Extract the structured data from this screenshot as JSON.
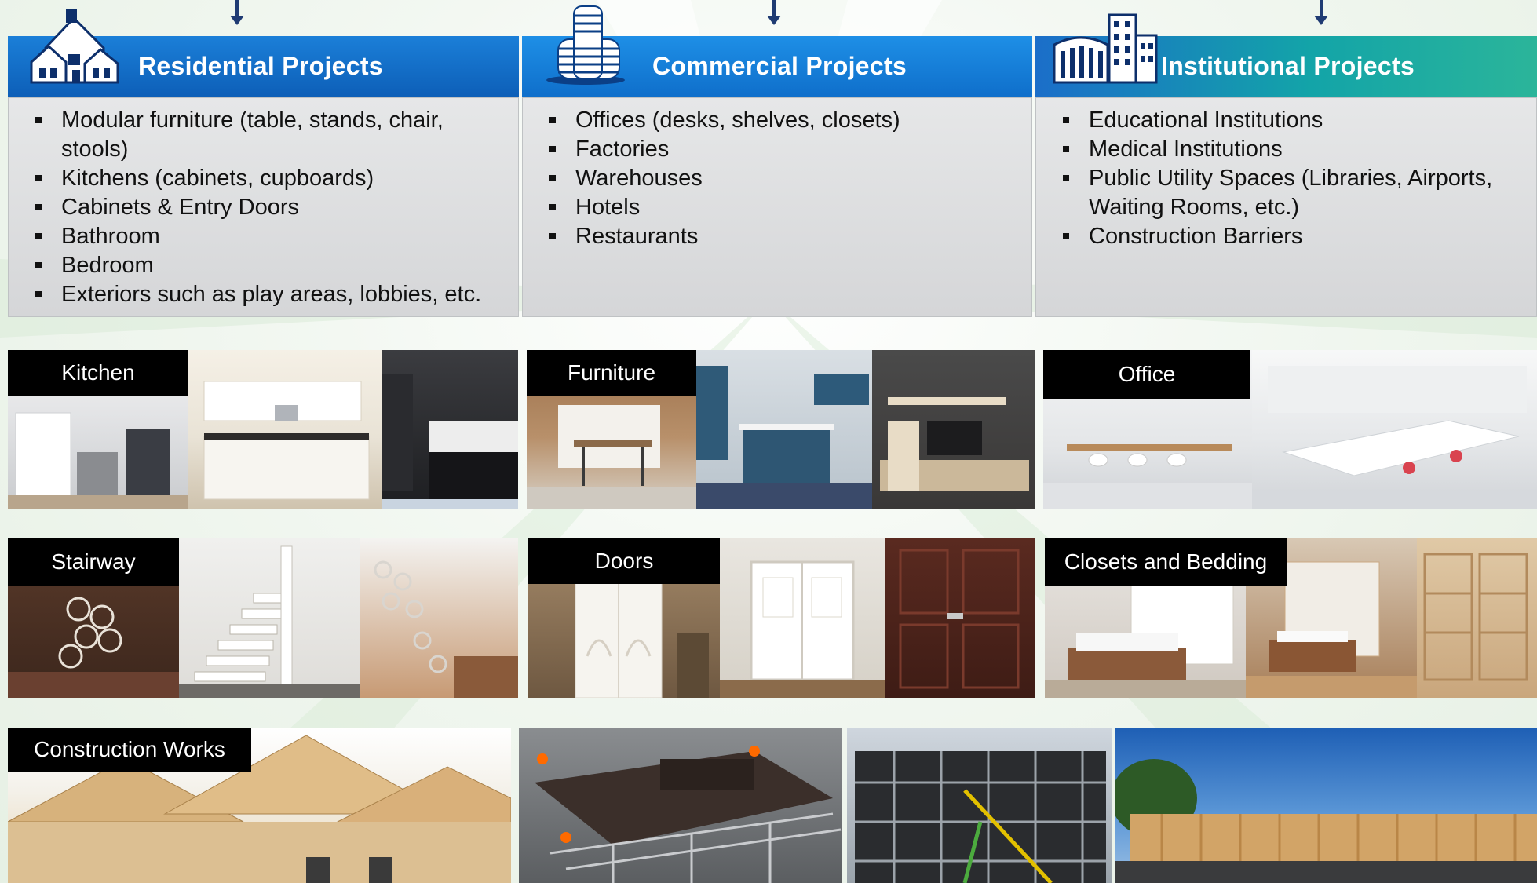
{
  "columns": [
    {
      "title": "Residential Projects",
      "icon": "houses-icon",
      "items": [
        "Modular furniture (table, stands, chair, stools)",
        "Kitchens (cabinets, cupboards)",
        "Cabinets & Entry Doors",
        "Bathroom",
        "Bedroom",
        "Exteriors such as play areas, lobbies, etc."
      ]
    },
    {
      "title": "Commercial Projects",
      "icon": "office-tower-icon",
      "items": [
        "Offices (desks, shelves, closets)",
        "Factories",
        "Warehouses",
        "Hotels",
        "Restaurants"
      ]
    },
    {
      "title": "Institutional Projects",
      "icon": "institution-buildings-icon",
      "items": [
        "Educational Institutions",
        "Medical Institutions",
        "Public Utility Spaces (Libraries, Airports, Waiting Rooms, etc.)",
        "Construction Barriers"
      ]
    }
  ],
  "tiles": {
    "kitchen": "Kitchen",
    "furniture": "Furniture",
    "office": "Office",
    "stairway": "Stairway",
    "doors": "Doors",
    "closets": "Closets and Bedding",
    "construction": "Construction Works"
  },
  "colors": {
    "header_blue": "#0d5fb8",
    "header_teal": "#13a4a8",
    "list_bg": "#dcdddf",
    "arrow": "#1f3b73"
  }
}
